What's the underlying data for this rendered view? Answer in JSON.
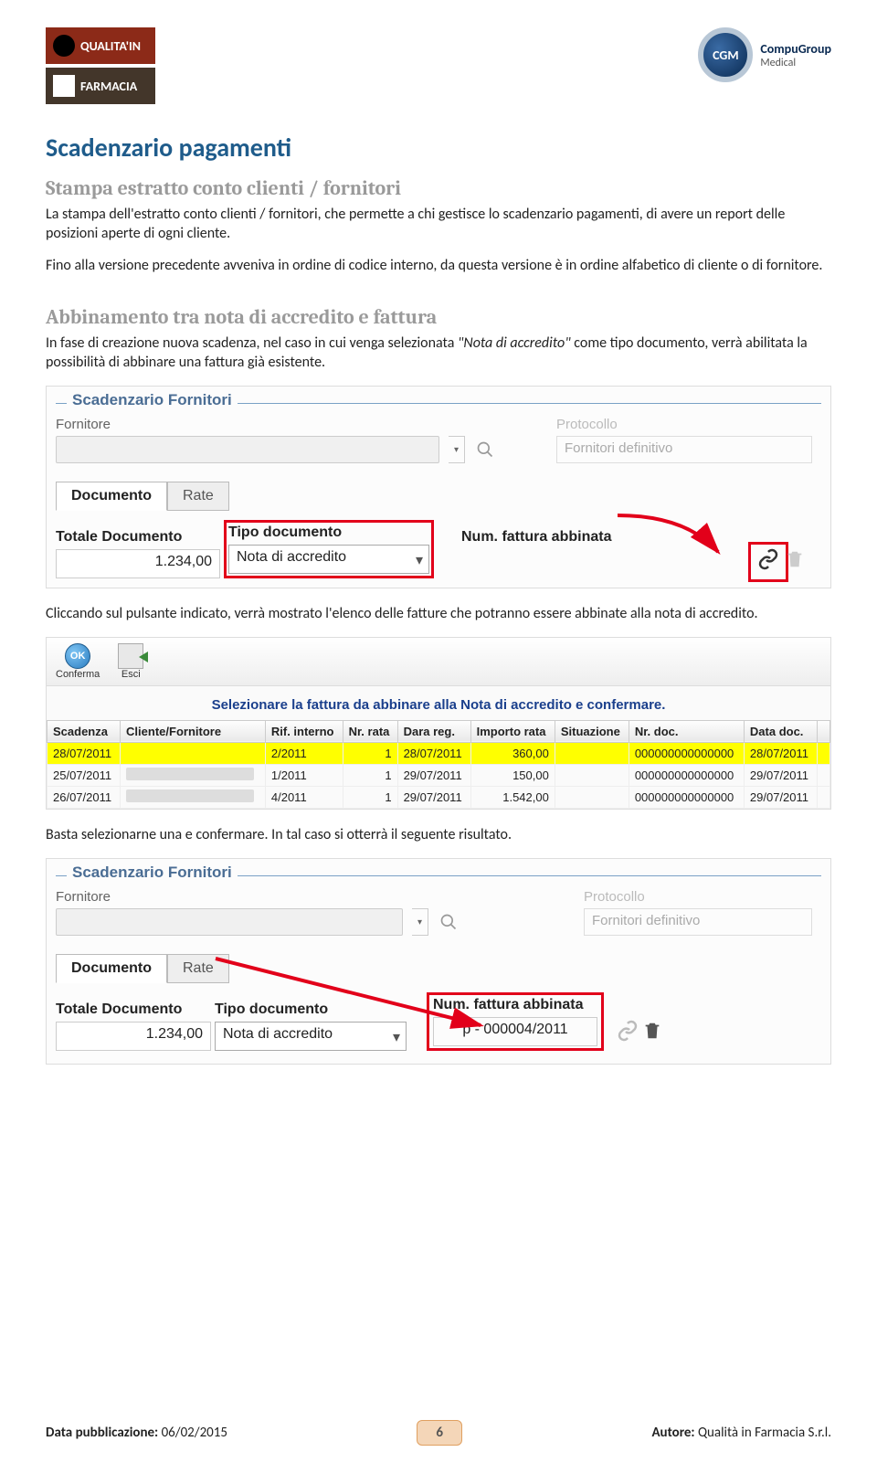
{
  "header": {
    "logo_left_1": "QUALITA'IN",
    "logo_left_2": "FARMACIA",
    "logo_right_badge": "CGM",
    "logo_right_text1": "CompuGroup",
    "logo_right_text2": "Medical"
  },
  "title": "Scadenzario pagamenti",
  "section1": {
    "heading": "Stampa estratto conto clienti / fornitori",
    "p1": "La stampa dell'estratto conto clienti / fornitori, che permette a chi gestisce lo scadenzario pagamenti, di avere un report delle posizioni aperte di ogni cliente.",
    "p2": "Fino alla versione precedente avveniva in ordine di codice interno, da questa versione è in ordine alfabetico di cliente o di fornitore."
  },
  "section2": {
    "heading": "Abbinamento tra nota di accredito e fattura",
    "p1a": "In fase di creazione nuova scadenza, nel caso in cui venga selezionata ",
    "p1b": "\"Nota di accredito\"",
    "p1c": " come tipo documento, verrà abilitata la possibilità di abbinare una fattura già esistente."
  },
  "shot1": {
    "legend": "Scadenzario Fornitori",
    "lbl_fornitore": "Fornitore",
    "lbl_protocollo": "Protocollo",
    "protocollo_val": "Fornitori definitivo",
    "tab1": "Documento",
    "tab2": "Rate",
    "lbl_totdoc": "Totale Documento",
    "val_totdoc": "1.234,00",
    "lbl_tipodoc": "Tipo documento",
    "val_tipodoc": "Nota di accredito",
    "lbl_numabb": "Num. fattura abbinata"
  },
  "para3": "Cliccando sul pulsante indicato, verrà mostrato l'elenco delle fatture che potranno essere abbinate alla nota di accredito.",
  "shot2": {
    "btn_conferma": "Conferma",
    "btn_esci": "Esci",
    "instruction": "Selezionare la fattura da abbinare alla Nota di accredito e confermare.",
    "cols": [
      "Scadenza",
      "Cliente/Fornitore",
      "Rif. interno",
      "Nr. rata",
      "Dara reg.",
      "Importo rata",
      "Situazione",
      "Nr. doc.",
      "Data doc."
    ],
    "rows": [
      {
        "scad": "28/07/2011",
        "rif": "2/2011",
        "rata": "1",
        "dreg": "28/07/2011",
        "imp": "360,00",
        "ndoc": "000000000000000",
        "ddoc": "28/07/2011",
        "hl": true
      },
      {
        "scad": "25/07/2011",
        "rif": "1/2011",
        "rata": "1",
        "dreg": "29/07/2011",
        "imp": "150,00",
        "ndoc": "000000000000000",
        "ddoc": "29/07/2011",
        "hl": false
      },
      {
        "scad": "26/07/2011",
        "rif": "4/2011",
        "rata": "1",
        "dreg": "29/07/2011",
        "imp": "1.542,00",
        "ndoc": "000000000000000",
        "ddoc": "29/07/2011",
        "hl": false
      }
    ]
  },
  "para4": "Basta selezionarne una e confermare. In tal caso si otterrà il seguente risultato.",
  "shot3": {
    "legend": "Scadenzario Fornitori",
    "lbl_fornitore": "Fornitore",
    "lbl_protocollo": "Protocollo",
    "protocollo_val": "Fornitori definitivo",
    "tab1": "Documento",
    "tab2": "Rate",
    "lbl_totdoc": "Totale Documento",
    "val_totdoc": "1.234,00",
    "lbl_tipodoc": "Tipo documento",
    "val_tipodoc": "Nota di accredito",
    "lbl_numabb": "Num. fattura abbinata",
    "val_numabb": "p - 000004/2011"
  },
  "footer": {
    "left_lbl": "Data pubblicazione:",
    "left_val": " 06/02/2015",
    "page": "6",
    "right_lbl": "Autore:",
    "right_val": " Qualità in Farmacia S.r.l."
  }
}
